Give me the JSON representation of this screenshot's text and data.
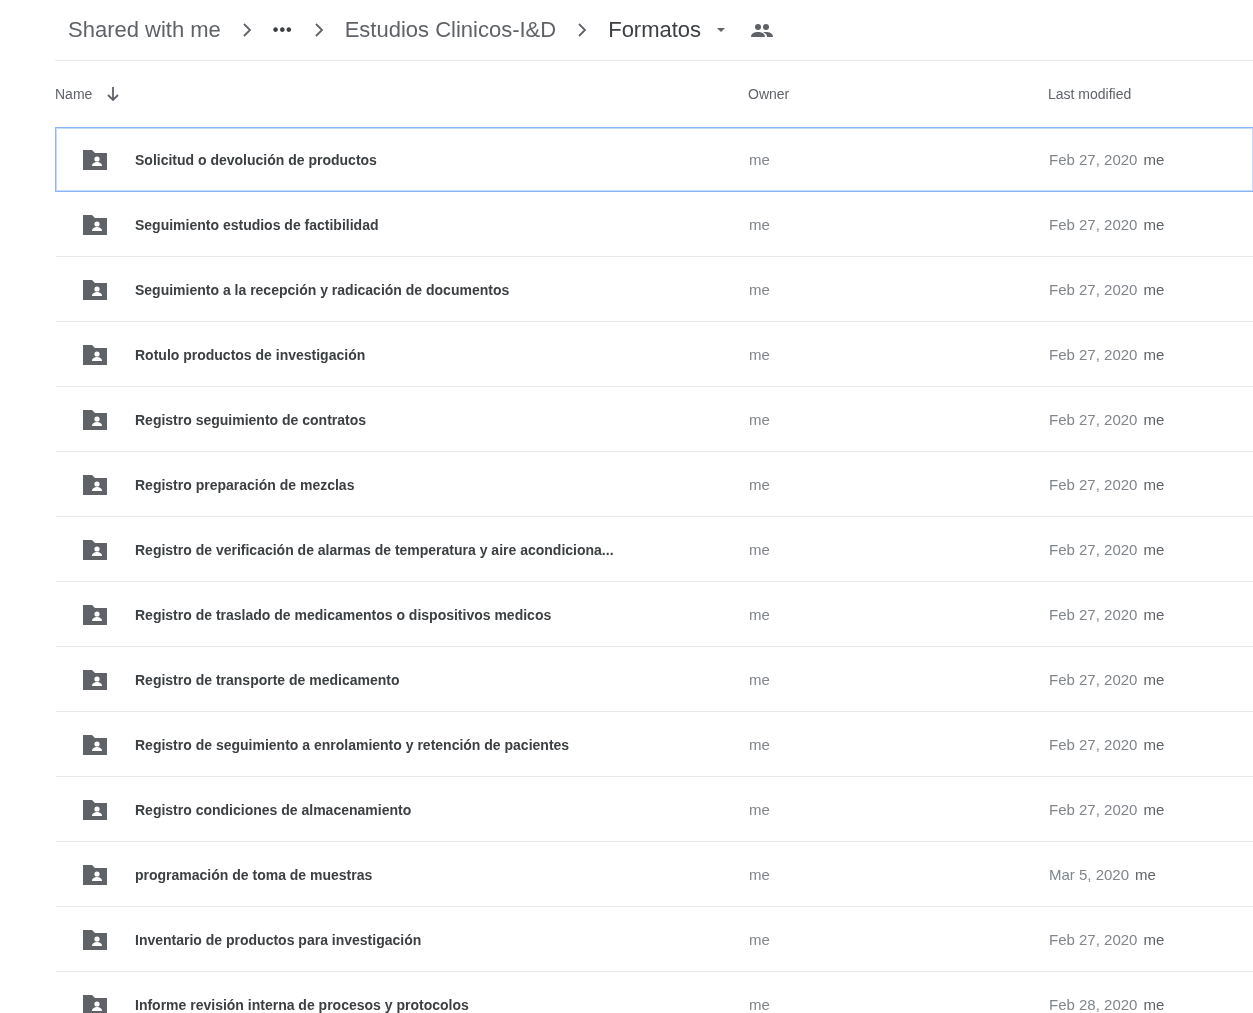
{
  "breadcrumb": [
    {
      "label": "Shared with me",
      "kind": "link"
    },
    {
      "label": "•••",
      "kind": "more"
    },
    {
      "label": "Estudios Clinicos-I&D",
      "kind": "link"
    },
    {
      "label": "Formatos",
      "kind": "current"
    }
  ],
  "columns": {
    "name": "Name",
    "owner": "Owner",
    "modified": "Last modified"
  },
  "rows": [
    {
      "name": "Solicitud o devolución de productos",
      "owner": "me",
      "modified": "Feb 27, 2020",
      "modified_by": "me",
      "selected": true
    },
    {
      "name": "Seguimiento estudios de factibilidad",
      "owner": "me",
      "modified": "Feb 27, 2020",
      "modified_by": "me",
      "selected": false
    },
    {
      "name": "Seguimiento a la recepción y radicación de documentos",
      "owner": "me",
      "modified": "Feb 27, 2020",
      "modified_by": "me",
      "selected": false
    },
    {
      "name": "Rotulo productos de investigación",
      "owner": "me",
      "modified": "Feb 27, 2020",
      "modified_by": "me",
      "selected": false
    },
    {
      "name": "Registro seguimiento de contratos",
      "owner": "me",
      "modified": "Feb 27, 2020",
      "modified_by": "me",
      "selected": false
    },
    {
      "name": "Registro preparación de mezclas",
      "owner": "me",
      "modified": "Feb 27, 2020",
      "modified_by": "me",
      "selected": false
    },
    {
      "name": "Registro de verificación de alarmas de temperatura y aire acondiciona...",
      "owner": "me",
      "modified": "Feb 27, 2020",
      "modified_by": "me",
      "selected": false
    },
    {
      "name": "Registro de traslado de medicamentos o dispositivos medicos",
      "owner": "me",
      "modified": "Feb 27, 2020",
      "modified_by": "me",
      "selected": false
    },
    {
      "name": "Registro de transporte de medicamento",
      "owner": "me",
      "modified": "Feb 27, 2020",
      "modified_by": "me",
      "selected": false
    },
    {
      "name": "Registro de seguimiento a enrolamiento y retención de pacientes",
      "owner": "me",
      "modified": "Feb 27, 2020",
      "modified_by": "me",
      "selected": false
    },
    {
      "name": "Registro condiciones de almacenamiento",
      "owner": "me",
      "modified": "Feb 27, 2020",
      "modified_by": "me",
      "selected": false
    },
    {
      "name": "programación de toma de muestras",
      "owner": "me",
      "modified": "Mar 5, 2020",
      "modified_by": "me",
      "selected": false
    },
    {
      "name": "Inventario de productos para investigación",
      "owner": "me",
      "modified": "Feb 27, 2020",
      "modified_by": "me",
      "selected": false
    },
    {
      "name": "Informe revisión interna de procesos y protocolos",
      "owner": "me",
      "modified": "Feb 28, 2020",
      "modified_by": "me",
      "selected": false
    }
  ]
}
